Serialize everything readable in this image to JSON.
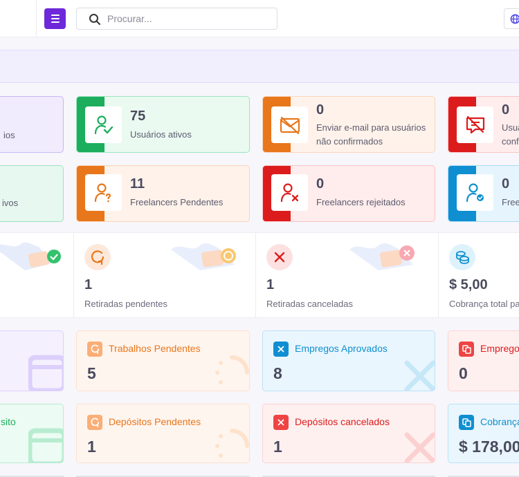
{
  "header": {
    "search_placeholder": "Procurar...",
    "menu_icon": "hamburger-icon",
    "language_icon": "globe-icon"
  },
  "user_cards": [
    {
      "value": "",
      "label": "ios"
    },
    {
      "value": "75",
      "label": "Usuários ativos"
    },
    {
      "value": "0",
      "label": "Enviar e-mail para usuários não confirmados"
    },
    {
      "value": "0",
      "label": "Usuá confi"
    }
  ],
  "freelancer_cards": [
    {
      "value": "",
      "label": "ivos"
    },
    {
      "value": "11",
      "label": "Freelancers Pendentes"
    },
    {
      "value": "0",
      "label": "Freelancers rejeitados"
    },
    {
      "value": "0",
      "label": "Freel"
    }
  ],
  "withdrawals": [
    {
      "value": "1",
      "label": "Retiradas pendentes"
    },
    {
      "value": "1",
      "label": "Retiradas canceladas"
    },
    {
      "value": "$ 5,00",
      "label": "Cobrança total par"
    }
  ],
  "jobs": [
    {
      "title": "Trabalhos Pendentes",
      "value": "5"
    },
    {
      "title": "Empregos Aprovados",
      "value": "8"
    },
    {
      "title": "Empregos",
      "value": "0"
    }
  ],
  "deposits": [
    {
      "title": "sito",
      "value": ""
    },
    {
      "title": "Depósitos Pendentes",
      "value": "1"
    },
    {
      "title": "Depósitos cancelados",
      "value": "1"
    },
    {
      "title": "Cobrança",
      "value": "$ 178,00"
    }
  ],
  "colors": {
    "accent": "#6d28d9",
    "green": "#1cae5c",
    "orange": "#e8761b",
    "red": "#dc1c1c",
    "blue": "#0f8fd1"
  }
}
